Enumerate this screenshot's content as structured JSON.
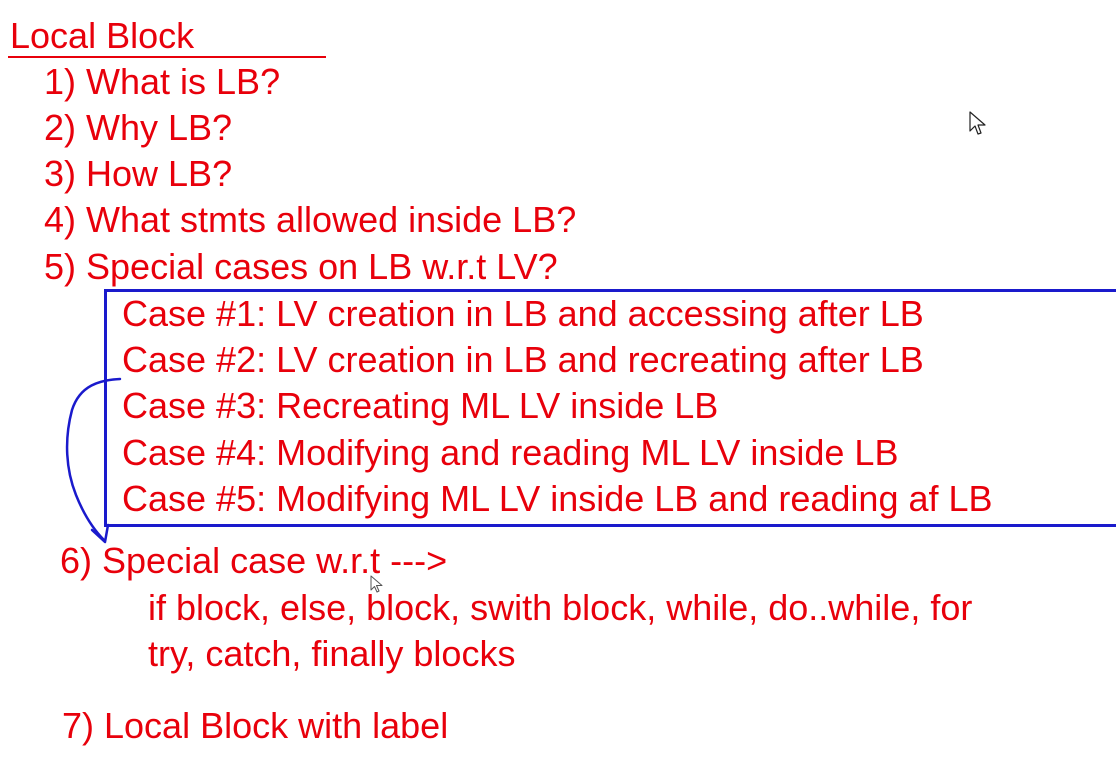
{
  "title": "Local Block",
  "items": [
    "1) What is LB?",
    "2) Why LB?",
    "3) How LB?",
    "4) What stmts allowed inside LB?",
    "5) Special cases on LB w.r.t LV?"
  ],
  "cases": [
    "Case #1: LV creation in LB and accessing after LB",
    "Case #2: LV creation in LB and recreating after LB",
    "Case #3: Recreating ML LV inside LB",
    "Case #4: Modifying and reading ML LV inside LB",
    "Case #5: Modifying ML LV inside LB and reading af LB"
  ],
  "item6": {
    "heading": "6) Special case w.r.t --->",
    "detail_line_1": "if block, else, block, swith block, while, do..while, for",
    "detail_line_2": "try, catch, finally blocks"
  },
  "item7": "7) Local Block with label",
  "colors": {
    "text": "#e8000b",
    "box": "#1a1acc",
    "annotation": "#1a1acc"
  },
  "icons": {
    "cursor_top": "mouse-pointer-icon",
    "cursor_text": "mouse-pointer-icon"
  }
}
